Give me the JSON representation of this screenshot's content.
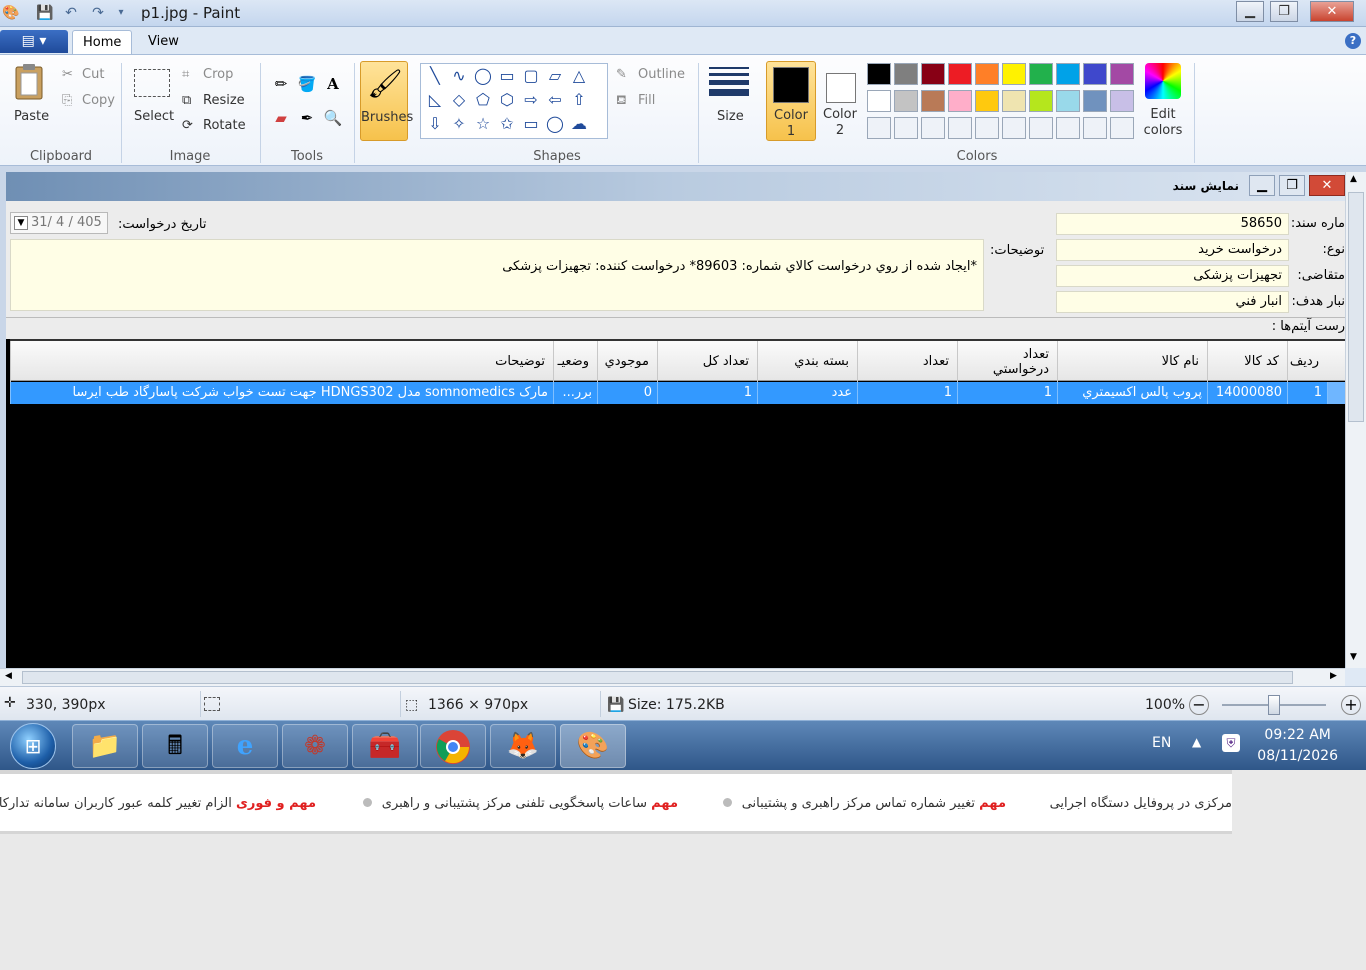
{
  "window": {
    "title": "p1.jpg - Paint",
    "minimize": "▁",
    "maximize": "❐",
    "close": "✕"
  },
  "ribbon": {
    "app_menu": "▤ ▾",
    "tabs": [
      "Home",
      "View"
    ],
    "help": "?",
    "clipboard": {
      "paste": "Paste",
      "cut": "Cut",
      "copy": "Copy",
      "group": "Clipboard"
    },
    "image": {
      "select": "Select",
      "crop": "Crop",
      "resize": "Resize",
      "rotate": "Rotate",
      "group": "Image"
    },
    "tools": {
      "group": "Tools"
    },
    "brushes": {
      "label": "Brushes"
    },
    "shapes": {
      "outline": "Outline",
      "fill": "Fill",
      "group": "Shapes"
    },
    "size": {
      "label": "Size"
    },
    "colors": {
      "color1": "Color\n1",
      "color2": "Color\n2",
      "edit": "Edit\ncolors",
      "group": "Colors",
      "palette_row1": [
        "#000000",
        "#7f7f7f",
        "#880015",
        "#ed1c24",
        "#ff7f27",
        "#fff200",
        "#22b14c",
        "#00a2e8",
        "#3f48cc",
        "#a349a4"
      ],
      "palette_row2": [
        "#ffffff",
        "#c3c3c3",
        "#b97a57",
        "#ffaec9",
        "#ffc90e",
        "#efe4b0",
        "#b5e61d",
        "#99d9ea",
        "#7092be",
        "#c8bfe7"
      ]
    }
  },
  "dialog": {
    "title": "نمایش سند",
    "doc_number_label": "ماره سند:",
    "doc_number": "58650",
    "type_label": "نوع:",
    "type": "درخواست خرید",
    "requester_label": "متقاضی:",
    "requester": "تجهیزات پزشکی",
    "target_label": "نبار هدف:",
    "target": "انبار فني",
    "date_label": "تاریخ درخواست:",
    "date": "31/ 4 / 405",
    "desc_label": "توضیحات:",
    "desc": "*ایجاد شده از روي درخواست كالاي شماره: 89603* درخواست کننده: تجهیزات پزشکی",
    "items_label": "رست آیتم‌ها :"
  },
  "table": {
    "headers": [
      "رديف",
      "کد کالا",
      "نام کالا",
      "تعداد درخواستي",
      "تعداد",
      "بسته بندي",
      "تعداد کل",
      "موجودي",
      "وضعيـ",
      "توضيحات"
    ],
    "rows": [
      [
        "1",
        "14000080",
        "پروب پالس اکسیمتري",
        "1",
        "1",
        "عدد",
        "1",
        "0",
        "برر...",
        "مارک somnomedics مدل HDNGS302 جهت تست خواب شرکت پاسارگاد طب ایرسا"
      ]
    ]
  },
  "status": {
    "cursor": "330, 390px",
    "dimensions": "1366 × 970px",
    "size": "Size: 175.2KB",
    "zoom": "100%"
  },
  "taskbar": {
    "lang": "EN",
    "time": "09:22 AM",
    "date": "08/11/2026"
  },
  "ticker": {
    "item1": "مرکزی در پروفایل دستگاه اجرایی",
    "tag2": "مهم",
    "item2": "تغییر شماره تماس مرکز راهبری و پشتیبانی",
    "tag3": "مهم",
    "item3": "ساعات پاسخگویی تلفنی مرکز پشتیبانی و راهبری",
    "tag4": "مهم و فوری",
    "item4": "الزام تغییر کلمه عبور کاربران سامانه تدارکا"
  }
}
